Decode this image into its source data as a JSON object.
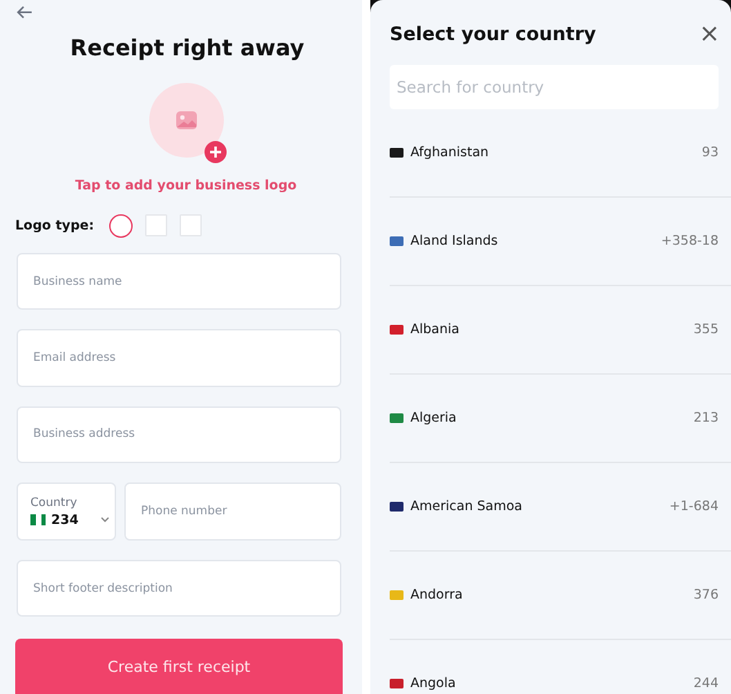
{
  "form": {
    "title": "Receipt right away",
    "logo_hint": "Tap to add your business logo",
    "logo_type_label": "Logo type:",
    "logo_types": [
      {
        "kind": "circle",
        "selected": true
      },
      {
        "kind": "square",
        "selected": false
      },
      {
        "kind": "square",
        "selected": false
      }
    ],
    "fields": [
      {
        "kind": "text",
        "placeholder": "Business name"
      },
      {
        "kind": "text",
        "placeholder": "Email address"
      },
      {
        "kind": "text",
        "placeholder": "Business address"
      },
      {
        "kind": "phone",
        "country_label": "Country",
        "country_code": "234",
        "color": "#0b8a45",
        "placeholder": "Phone number"
      },
      {
        "kind": "text",
        "placeholder": "Short footer description"
      }
    ],
    "submit": "Create first receipt"
  },
  "country_picker": {
    "title": "Select your country",
    "close": "×",
    "search": {
      "placeholder": "Search for country"
    },
    "countries": [
      {
        "name": "Afghanistan",
        "code": "93",
        "color": "#1a1a1a"
      },
      {
        "name": "Aland Islands",
        "code": "+358-18",
        "color": "#3d6db5"
      },
      {
        "name": "Albania",
        "code": "355",
        "color": "#d2202c"
      },
      {
        "name": "Algeria",
        "code": "213",
        "color": "#1f8a45"
      },
      {
        "name": "American Samoa",
        "code": "+1-684",
        "color": "#1f2a6b"
      },
      {
        "name": "Andorra",
        "code": "376",
        "color": "#e8b818"
      },
      {
        "name": "Angola",
        "code": "244",
        "color": "#c8202c"
      }
    ]
  }
}
